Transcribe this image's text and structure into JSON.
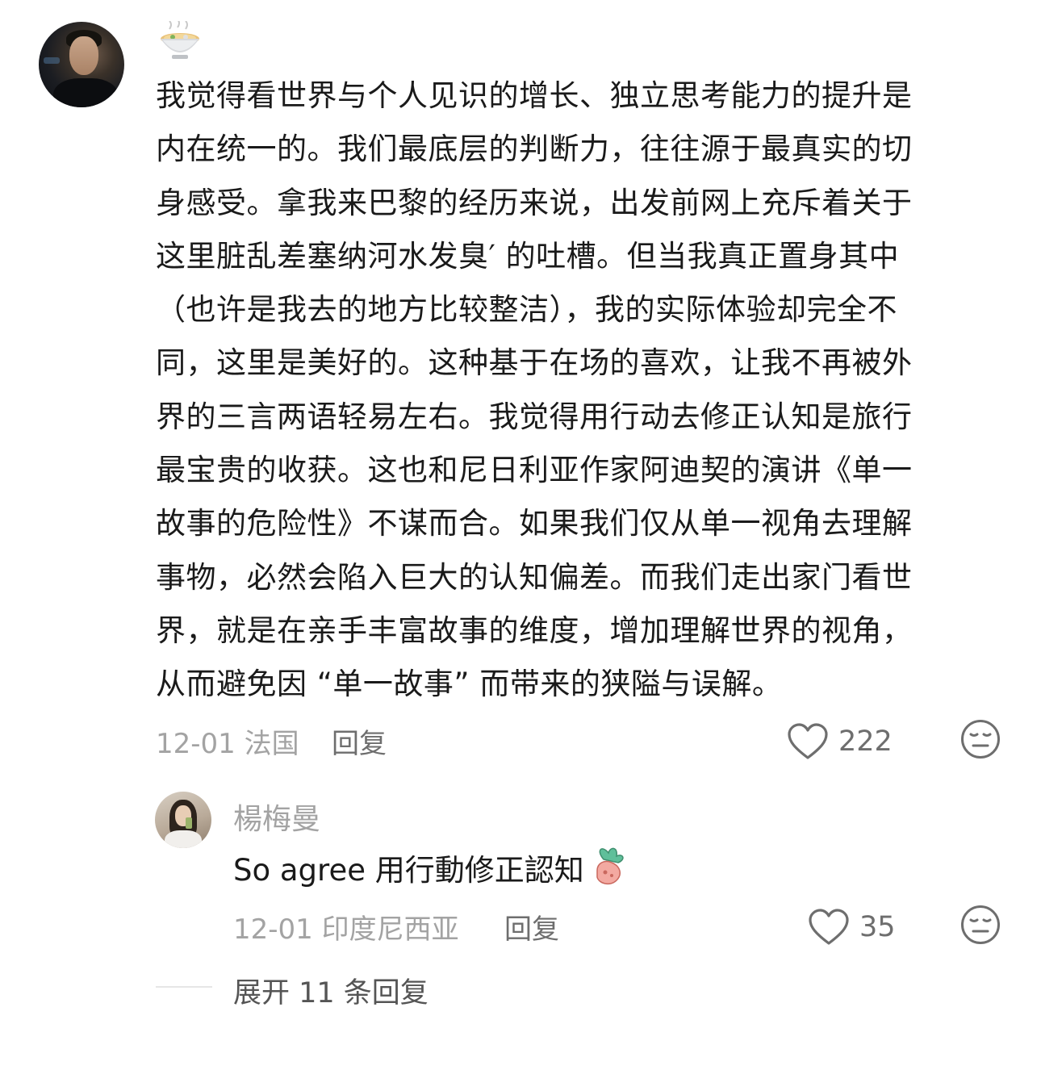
{
  "comment": {
    "author_badge_icon": "noodle-bowl-emoji",
    "text": "我觉得看世界与个人见识的增长、独立思考能力的提升是\n内在统一的。我们最底层的判断力，往往源于最真实的切\n身感受。拿我来巴黎的经历来说，出发前网上充斥着关于\n这里脏乱差塞纳河水发臭′ 的吐槽。但当我真正置身其中\n（也许是我去的地方比较整洁），我的实际体验却完全不\n同，这里是美好的。这种基于在场的喜欢，让我不再被外\n界的三言两语轻易左右。我觉得用行动去修正认知是旅行\n最宝贵的收获。这也和尼日利亚作家阿迪契的演讲《单一\n故事的危险性》不谋而合。如果我们仅从单一视角去理解\n事物，必然会陷入巨大的认知偏差。而我们走出家门看世\n界，就是在亲手丰富故事的维度，增加理解世界的视角，\n从而避免因 “单一故事” 而带来的狭隘与误解。",
    "date_location": "12-01 法国",
    "reply_label": "回复",
    "like_count": "222"
  },
  "reply": {
    "username": "楊梅曼",
    "text": "So agree 用行動修正認知",
    "sticker_icon": "radish-emoji",
    "date_location": "12-01 印度尼西亚",
    "reply_label": "回复",
    "like_count": "35"
  },
  "expand": {
    "label": "展开 11 条回复"
  },
  "colors": {
    "primary_text": "#1a1a1a",
    "secondary_text": "#a3a3a3",
    "action_text": "#6e6e6e",
    "icon_stroke": "#6e6e6e"
  }
}
